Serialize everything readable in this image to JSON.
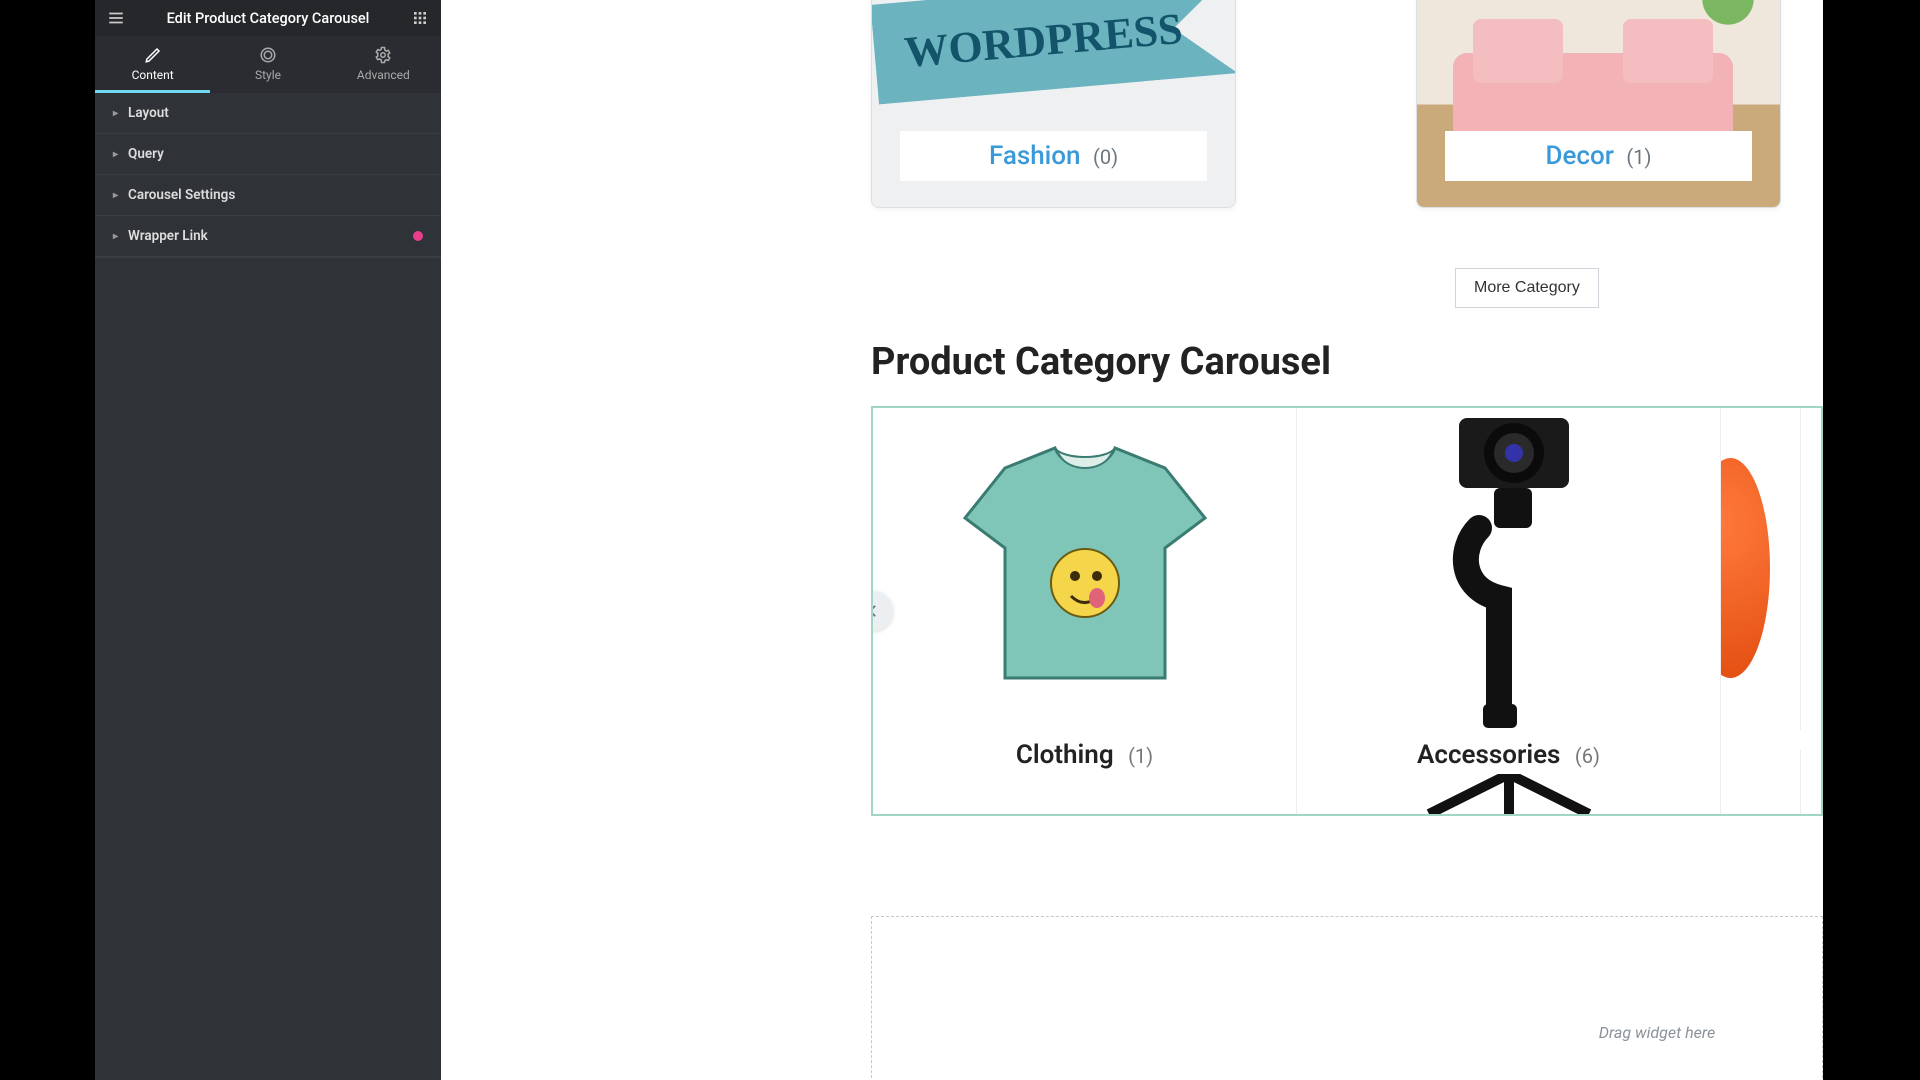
{
  "sidebar": {
    "title": "Edit Product Category Carousel",
    "tabs": [
      {
        "label": "Content",
        "active": true
      },
      {
        "label": "Style",
        "active": false
      },
      {
        "label": "Advanced",
        "active": false
      }
    ],
    "sections": [
      {
        "label": "Layout"
      },
      {
        "label": "Query"
      },
      {
        "label": "Carousel Settings"
      },
      {
        "label": "Wrapper Link",
        "badge": true
      }
    ]
  },
  "top_carousel": {
    "cards": [
      {
        "name": "Fashion",
        "count": "(0)"
      },
      {
        "name": "Decor",
        "count": "(1)"
      }
    ],
    "more_button": "More Category"
  },
  "section_title": "Product Category Carousel",
  "carousel": {
    "slides": [
      {
        "name": "Clothing",
        "count": "(1)"
      },
      {
        "name": "Accessories",
        "count": "(6)"
      }
    ]
  },
  "dropzone": {
    "hint": "Drag widget here"
  }
}
